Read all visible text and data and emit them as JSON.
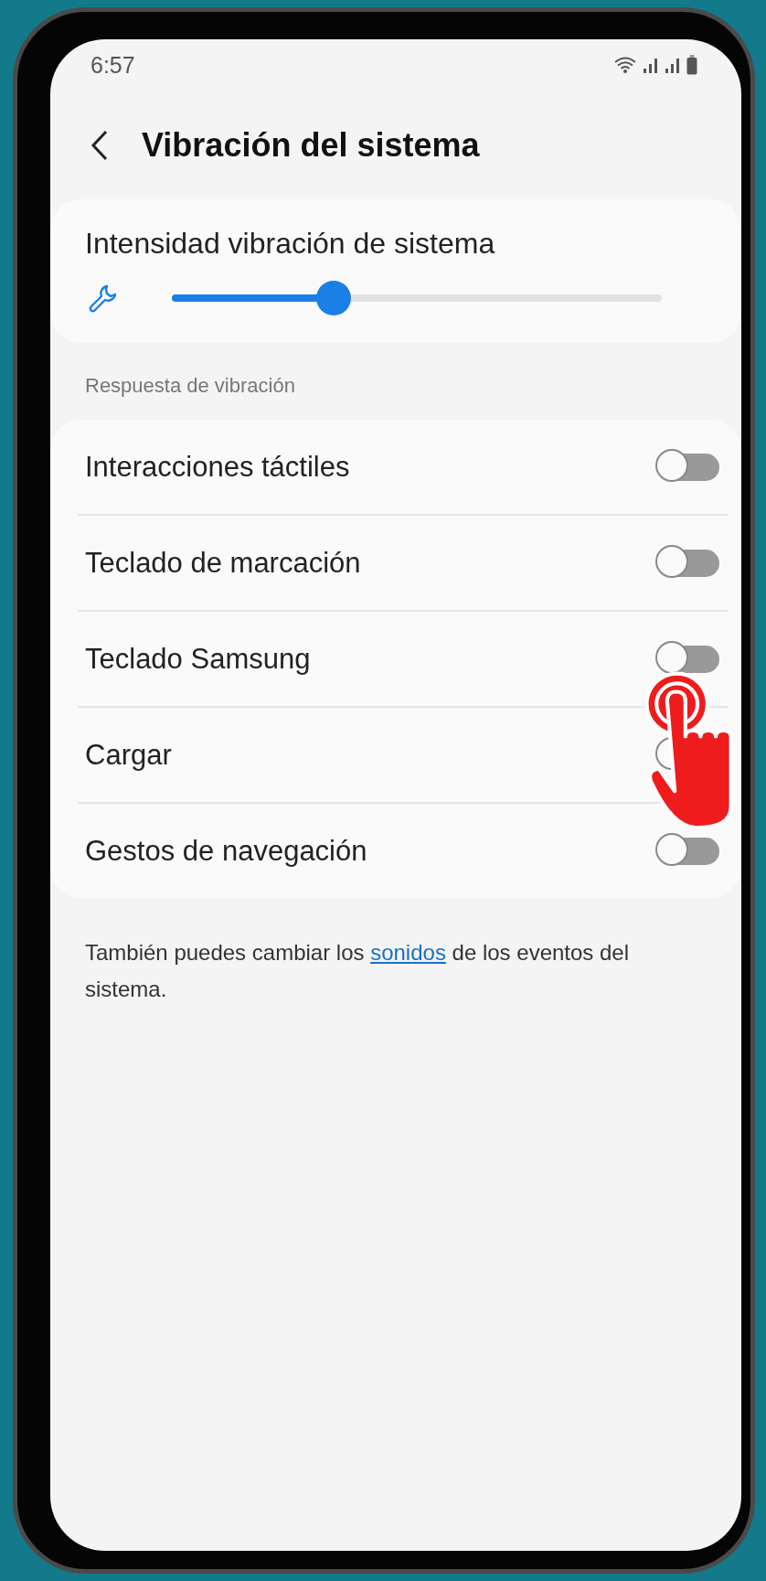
{
  "status_bar": {
    "time": "6:57"
  },
  "header": {
    "title": "Vibración del sistema"
  },
  "intensity": {
    "label": "Intensidad vibración de sistema",
    "level": 0.33
  },
  "section": {
    "title": "Respuesta de vibración"
  },
  "settings": [
    {
      "label": "Interacciones táctiles",
      "on": false
    },
    {
      "label": "Teclado de marcación",
      "on": false
    },
    {
      "label": "Teclado Samsung",
      "on": false
    },
    {
      "label": "Cargar",
      "on": false
    },
    {
      "label": "Gestos de navegación",
      "on": false
    }
  ],
  "footer": {
    "before": "También puedes cambiar los ",
    "link": "sonidos",
    "after": " de los eventos del sistema."
  }
}
